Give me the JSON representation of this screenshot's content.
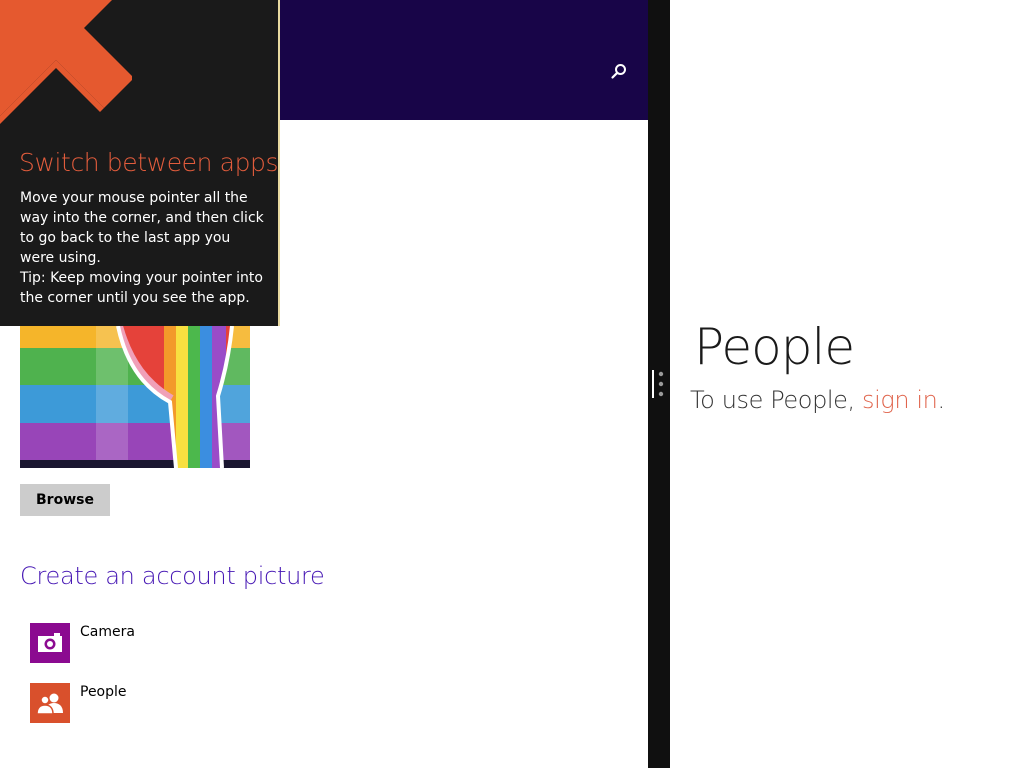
{
  "colors": {
    "header_band": "#180548",
    "accent_purple": "#4617b4",
    "tip_background": "#1a1a1a",
    "tip_accent": "#e25c3c",
    "camera_tile": "#8b0a90",
    "people_tile": "#d9502c",
    "link": "#e0654d",
    "splitter": "#101010"
  },
  "header": {
    "search_icon": "search-icon"
  },
  "tip": {
    "arrow_icon": "arrow-up-left-icon",
    "title": "Switch between apps",
    "body": "Move your mouse pointer all the way into the corner, and then click to go back to the last app you were using.",
    "tip_text": "Tip: Keep moving your pointer into the corner until you see the app."
  },
  "account_picture": {
    "browse_label": "Browse"
  },
  "create_picture": {
    "title": "Create an account picture",
    "options": [
      {
        "label": "Camera",
        "icon": "camera-icon"
      },
      {
        "label": "People",
        "icon": "people-icon"
      }
    ]
  },
  "splitter": {
    "grip_icon": "splitter-grip-icon"
  },
  "people_app": {
    "title": "People",
    "message_prefix": "To use People, ",
    "sign_in_link": "sign in",
    "message_suffix": "."
  }
}
